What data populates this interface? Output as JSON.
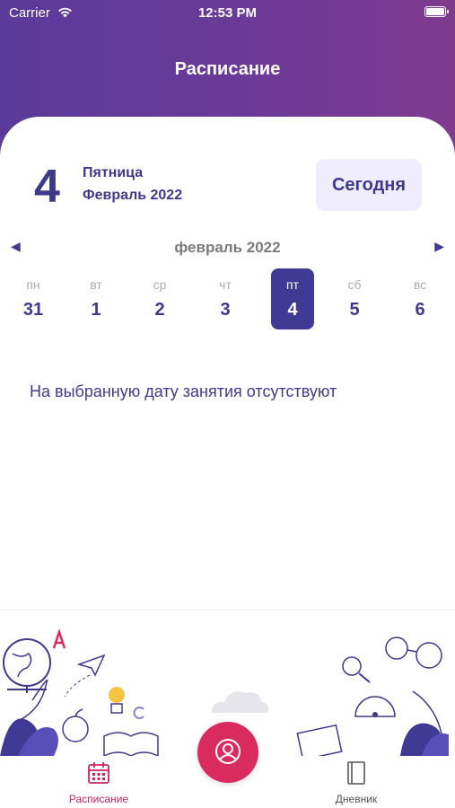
{
  "status_bar": {
    "carrier": "Carrier",
    "time": "12:53 PM"
  },
  "header": {
    "title": "Расписание"
  },
  "selected_date": {
    "day": "4",
    "weekday": "Пятница",
    "month_year": "Февраль 2022"
  },
  "today_button": {
    "label": "Сегодня"
  },
  "calendar": {
    "month_label": "февраль 2022",
    "days": [
      {
        "name": "пн",
        "date": "31"
      },
      {
        "name": "вт",
        "date": "1"
      },
      {
        "name": "ср",
        "date": "2"
      },
      {
        "name": "чт",
        "date": "3"
      },
      {
        "name": "пт",
        "date": "4"
      },
      {
        "name": "сб",
        "date": "5"
      },
      {
        "name": "вс",
        "date": "6"
      }
    ]
  },
  "empty_message": "На выбранную дату занятия отсутствуют",
  "tabs": {
    "schedule_label": "Расписание",
    "diary_label": "Дневник"
  },
  "colors": {
    "accent": "#3d3a8c",
    "selected_day": "#3f3a94",
    "tab_active": "#c9245a",
    "fab": "#d92b5f"
  }
}
